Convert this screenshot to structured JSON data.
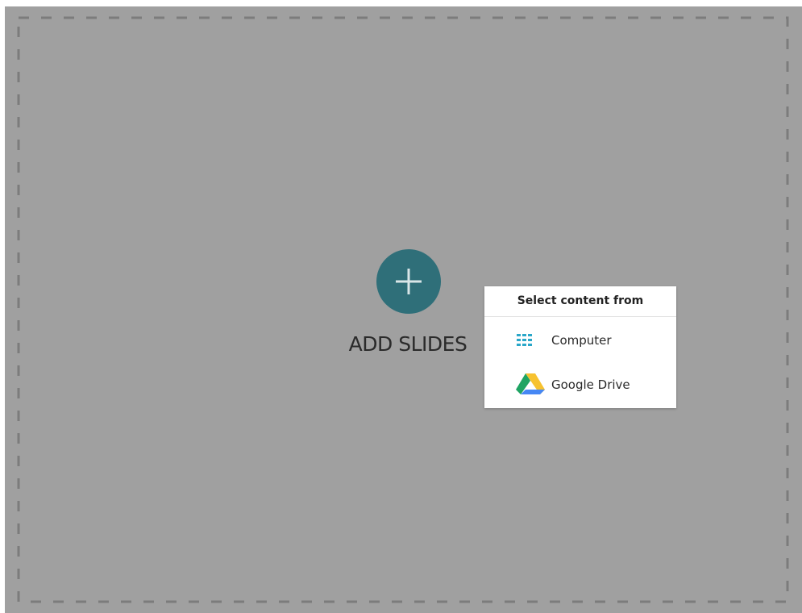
{
  "add_slides": {
    "label": "ADD SLIDES",
    "button_icon": "plus-icon",
    "button_color": "#2f6f79"
  },
  "content_menu": {
    "title": "Select content from",
    "items": [
      {
        "label": "Computer",
        "icon": "computer-grid-icon"
      },
      {
        "label": "Google Drive",
        "icon": "google-drive-icon"
      }
    ]
  },
  "colors": {
    "background": "#a0a0a0",
    "dash": "#7c7c7c",
    "menu_background": "#ffffff"
  }
}
